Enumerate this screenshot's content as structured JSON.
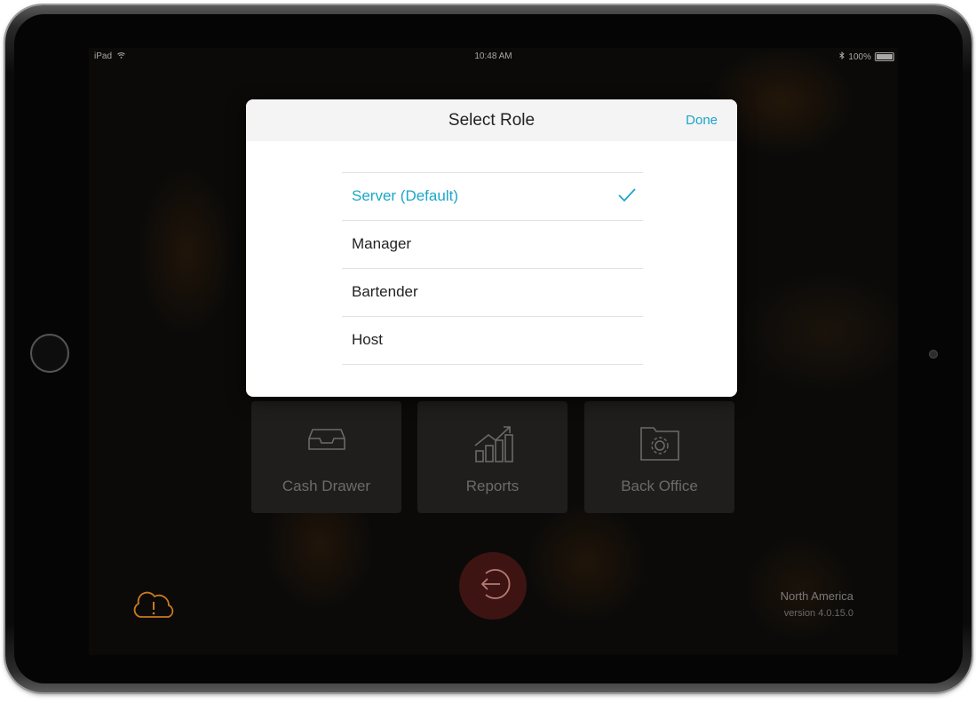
{
  "status_bar": {
    "device": "iPad",
    "time": "10:48 AM",
    "battery": "100%"
  },
  "tiles": [
    {
      "label": "Cash Drawer",
      "icon": "tray-icon"
    },
    {
      "label": "Reports",
      "icon": "chart-growth-icon"
    },
    {
      "label": "Back Office",
      "icon": "folder-gear-icon"
    }
  ],
  "footer": {
    "region": "North America",
    "version": "version 4.0.15.0",
    "logout_icon": "logout-icon",
    "cloud_icon": "cloud-alert-icon"
  },
  "modal": {
    "title": "Select Role",
    "done_label": "Done",
    "roles": [
      {
        "label": "Server (Default)",
        "selected": true
      },
      {
        "label": "Manager",
        "selected": false
      },
      {
        "label": "Bartender",
        "selected": false
      },
      {
        "label": "Host",
        "selected": false
      }
    ]
  },
  "colors": {
    "accent": "#1aa7c8",
    "cloud_alert": "#c97a1f",
    "logout_bg": "#3d1412"
  }
}
